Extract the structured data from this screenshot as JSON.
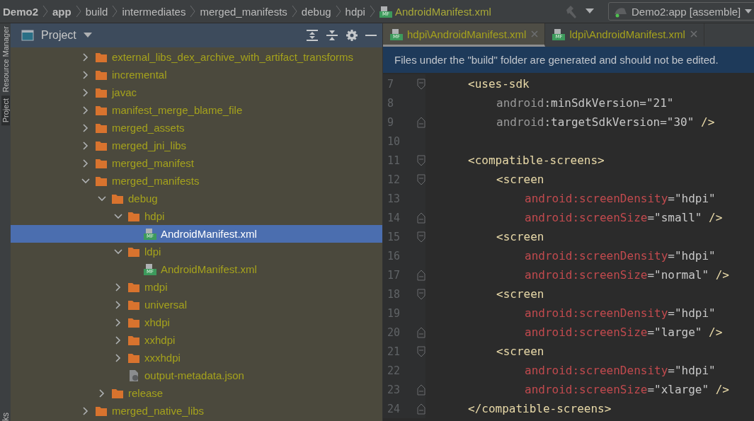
{
  "breadcrumb": [
    {
      "label": "Demo2",
      "kind": "module"
    },
    {
      "label": "app",
      "kind": "module"
    },
    {
      "label": "build",
      "kind": "folder"
    },
    {
      "label": "intermediates",
      "kind": "folder"
    },
    {
      "label": "merged_manifests",
      "kind": "folder"
    },
    {
      "label": "debug",
      "kind": "folder"
    },
    {
      "label": "hdpi",
      "kind": "folder"
    },
    {
      "label": "AndroidManifest.xml",
      "kind": "manifest",
      "badge": "MF"
    }
  ],
  "run_config": {
    "label": "Demo2:app [assemble]"
  },
  "side_strip": {
    "tabs": [
      {
        "label": "Resource Manager",
        "selected": false
      },
      {
        "label": "Project",
        "selected": true
      }
    ],
    "bottom_label": "ks"
  },
  "project_panel": {
    "title": "Project",
    "tree": [
      {
        "label": "external_libs_dex_archive_with_artifact_transforms",
        "kind": "folder",
        "expanded": false,
        "selected": false
      },
      {
        "label": "incremental",
        "kind": "folder",
        "expanded": false,
        "selected": false
      },
      {
        "label": "javac",
        "kind": "folder",
        "expanded": false,
        "selected": false
      },
      {
        "label": "manifest_merge_blame_file",
        "kind": "folder",
        "expanded": false,
        "selected": false
      },
      {
        "label": "merged_assets",
        "kind": "folder",
        "expanded": false,
        "selected": false
      },
      {
        "label": "merged_jni_libs",
        "kind": "folder",
        "expanded": false,
        "selected": false
      },
      {
        "label": "merged_manifest",
        "kind": "folder",
        "expanded": false,
        "selected": false
      },
      {
        "label": "merged_manifests",
        "kind": "folder",
        "expanded": true,
        "selected": false,
        "children": [
          {
            "label": "debug",
            "kind": "folder",
            "expanded": true,
            "selected": false,
            "children": [
              {
                "label": "hdpi",
                "kind": "folder",
                "expanded": true,
                "selected": false,
                "children": [
                  {
                    "label": "AndroidManifest.xml",
                    "kind": "manifest",
                    "badge": "MF",
                    "selected": true
                  }
                ]
              },
              {
                "label": "ldpi",
                "kind": "folder",
                "expanded": true,
                "selected": false,
                "children": [
                  {
                    "label": "AndroidManifest.xml",
                    "kind": "manifest",
                    "badge": "MF",
                    "selected": false
                  }
                ]
              },
              {
                "label": "mdpi",
                "kind": "folder",
                "expanded": false,
                "selected": false
              },
              {
                "label": "universal",
                "kind": "folder",
                "expanded": false,
                "selected": false
              },
              {
                "label": "xhdpi",
                "kind": "folder",
                "expanded": false,
                "selected": false
              },
              {
                "label": "xxhdpi",
                "kind": "folder",
                "expanded": false,
                "selected": false
              },
              {
                "label": "xxxhdpi",
                "kind": "folder",
                "expanded": false,
                "selected": false
              },
              {
                "label": "output-metadata.json",
                "kind": "json",
                "selected": false
              }
            ]
          },
          {
            "label": "release",
            "kind": "folder",
            "expanded": false,
            "selected": false
          }
        ]
      },
      {
        "label": "merged_native_libs",
        "kind": "folder",
        "expanded": false,
        "selected": false
      }
    ]
  },
  "editor": {
    "tabs": [
      {
        "label": "hdpi\\AndroidManifest.xml",
        "badge": "MF",
        "selected": true
      },
      {
        "label": "ldpi\\AndroidManifest.xml",
        "badge": "MF",
        "selected": false
      }
    ],
    "banner": "Files under the \"build\" folder are generated and should not be edited.",
    "lines": [
      {
        "number": "7",
        "fold": {
          "kind": "start"
        },
        "tokens": [
          {
            "text": "<uses-sdk",
            "kind": "tag"
          }
        ],
        "children": [
          {
            "number": "8",
            "tokens": [
              {
                "text": "android",
                "kind": "namespace"
              },
              {
                "text": ":minSdkVersion",
                "kind": "attribute"
              },
              {
                "text": "=\"21\"",
                "kind": "value"
              }
            ]
          },
          {
            "number": "9",
            "fold": {
              "kind": "end"
            },
            "tokens": [
              {
                "text": "android",
                "kind": "namespace"
              },
              {
                "text": ":targetSdkVersion",
                "kind": "attribute"
              },
              {
                "text": "=\"30\"",
                "kind": "value"
              },
              {
                "text": " />",
                "kind": "tag"
              }
            ]
          }
        ]
      },
      {
        "number": "10"
      },
      {
        "number": "11",
        "fold": {
          "kind": "start"
        },
        "tokens": [
          {
            "text": "<compatible-screens>",
            "kind": "tag"
          }
        ],
        "children": [
          {
            "number": "12",
            "fold": {
              "kind": "start"
            },
            "tokens": [
              {
                "text": "<screen",
                "kind": "tag"
              }
            ],
            "children": [
              {
                "number": "13",
                "tokens": [
                  {
                    "text": "android:screenDensity",
                    "kind": "error"
                  },
                  {
                    "text": "=\"hdpi\"",
                    "kind": "value"
                  }
                ]
              },
              {
                "number": "14",
                "fold": {
                  "kind": "end"
                },
                "tokens": [
                  {
                    "text": "android:screenSize",
                    "kind": "error"
                  },
                  {
                    "text": "=\"small\"",
                    "kind": "value"
                  },
                  {
                    "text": " />",
                    "kind": "tag"
                  }
                ]
              }
            ]
          },
          {
            "number": "15",
            "fold": {
              "kind": "start"
            },
            "tokens": [
              {
                "text": "<screen",
                "kind": "tag"
              }
            ],
            "children": [
              {
                "number": "16",
                "tokens": [
                  {
                    "text": "android:screenDensity",
                    "kind": "error"
                  },
                  {
                    "text": "=\"hdpi\"",
                    "kind": "value"
                  }
                ]
              },
              {
                "number": "17",
                "fold": {
                  "kind": "end"
                },
                "tokens": [
                  {
                    "text": "android:screenSize",
                    "kind": "error"
                  },
                  {
                    "text": "=\"normal\"",
                    "kind": "value"
                  },
                  {
                    "text": " />",
                    "kind": "tag"
                  }
                ]
              }
            ]
          },
          {
            "number": "18",
            "fold": {
              "kind": "start"
            },
            "tokens": [
              {
                "text": "<screen",
                "kind": "tag"
              }
            ],
            "children": [
              {
                "number": "19",
                "tokens": [
                  {
                    "text": "android:screenDensity",
                    "kind": "error"
                  },
                  {
                    "text": "=\"hdpi\"",
                    "kind": "value"
                  }
                ]
              },
              {
                "number": "20",
                "fold": {
                  "kind": "end"
                },
                "tokens": [
                  {
                    "text": "android:screenSize",
                    "kind": "error"
                  },
                  {
                    "text": "=\"large\"",
                    "kind": "value"
                  },
                  {
                    "text": " />",
                    "kind": "tag"
                  }
                ]
              }
            ]
          },
          {
            "number": "21",
            "fold": {
              "kind": "start"
            },
            "tokens": [
              {
                "text": "<screen",
                "kind": "tag"
              }
            ],
            "children": [
              {
                "number": "22",
                "tokens": [
                  {
                    "text": "android:screenDensity",
                    "kind": "error"
                  },
                  {
                    "text": "=\"hdpi\"",
                    "kind": "value"
                  }
                ]
              },
              {
                "number": "23",
                "fold": {
                  "kind": "end"
                },
                "tokens": [
                  {
                    "text": "android:screenSize",
                    "kind": "error"
                  },
                  {
                    "text": "=\"xlarge\"",
                    "kind": "value"
                  },
                  {
                    "text": " />",
                    "kind": "tag"
                  }
                ]
              }
            ]
          }
        ]
      },
      {
        "number": "24",
        "fold": {
          "kind": "end"
        },
        "tokens": [
          {
            "text": "</compatible-screens>",
            "kind": "tag"
          }
        ]
      }
    ]
  }
}
